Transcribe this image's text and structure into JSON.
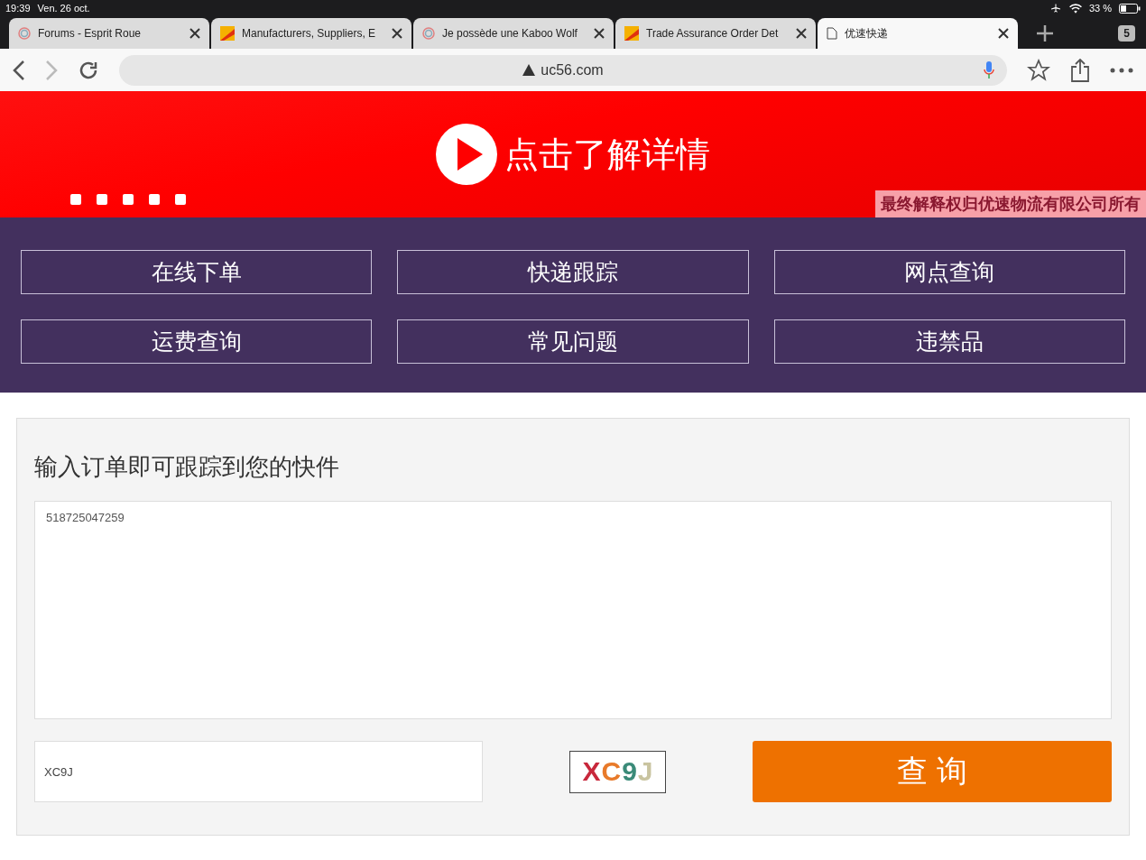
{
  "status_bar": {
    "time": "19:39",
    "date": "Ven. 26 oct.",
    "battery": "33 %"
  },
  "tabs": [
    {
      "title": "Forums - Esprit Roue",
      "kind": "ring",
      "selected": false
    },
    {
      "title": "Manufacturers, Suppliers, E",
      "kind": "logo",
      "selected": false
    },
    {
      "title": "Je possède une Kaboo Wolf",
      "kind": "ring",
      "selected": false
    },
    {
      "title": "Trade Assurance Order Det",
      "kind": "logo",
      "selected": false
    },
    {
      "title": "优速快递",
      "kind": "page",
      "selected": true
    }
  ],
  "tab_count": "5",
  "address_bar": {
    "url": "uc56.com"
  },
  "banner": {
    "headline": "点击了解详情",
    "footnote": "最终解释权归优速物流有限公司所有"
  },
  "nav_buttons": [
    "在线下单",
    "快递跟踪",
    "网点查询",
    "运费查询",
    "常见问题",
    "违禁品"
  ],
  "tracking": {
    "title": "输入订单即可跟踪到您的快件",
    "numbers": "518725047259",
    "captcha_value": "XC9J",
    "captcha": [
      {
        "char": "X",
        "color": "#c8283c"
      },
      {
        "char": "C",
        "color": "#e87a2a"
      },
      {
        "char": "9",
        "color": "#3a8a78"
      },
      {
        "char": "J",
        "color": "#c9c4a0"
      }
    ],
    "submit": "查 询"
  }
}
